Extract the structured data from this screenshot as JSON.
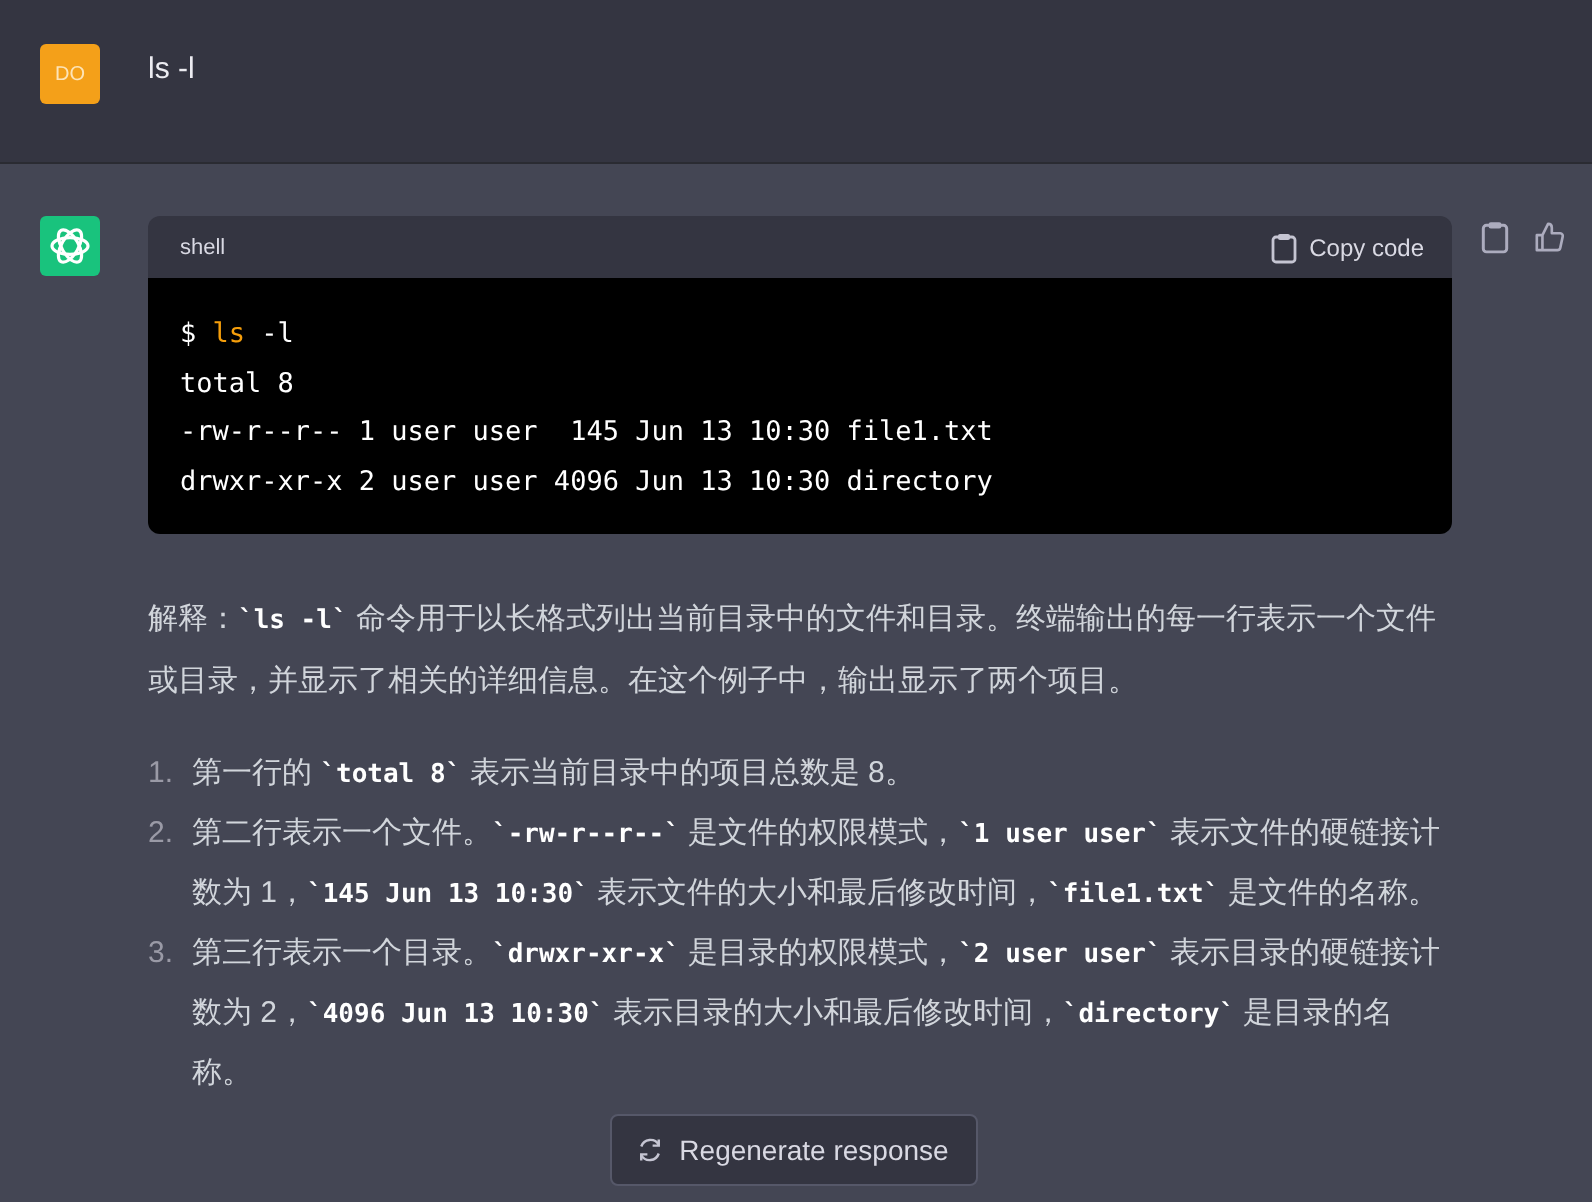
{
  "user_message": {
    "avatar": "DO",
    "text": "ls -l"
  },
  "code_block": {
    "language": "shell",
    "copy_label": "Copy code",
    "lines": [
      {
        "kind": "command",
        "prompt": "$",
        "command": "ls",
        "args": "-l"
      },
      {
        "kind": "output",
        "text": "total 8"
      },
      {
        "kind": "output",
        "text": "-rw-r--r-- 1 user user  145 Jun 13 10:30 file1.txt"
      },
      {
        "kind": "output",
        "text": "drwxr-xr-x 2 user user 4096 Jun 13 10:30 directory"
      }
    ]
  },
  "paragraph": [
    {
      "kind": "text",
      "text": "解释："
    },
    {
      "kind": "code",
      "text": "`ls -l`"
    },
    {
      "kind": "text",
      "text": " 命令用于以长格式列出当前目录中的文件和目录。终端输出的每一行表示一个文件或目录，并显示了相关的详细信息。在这个例子中，输出显示了两个项目。"
    }
  ],
  "list": [
    {
      "number": "1.",
      "segments": [
        {
          "kind": "text",
          "text": "第一行的 "
        },
        {
          "kind": "code",
          "text": "`total 8`"
        },
        {
          "kind": "text",
          "text": " 表示当前目录中的项目总数是 8。"
        }
      ]
    },
    {
      "number": "2.",
      "segments": [
        {
          "kind": "text",
          "text": "第二行表示一个文件。"
        },
        {
          "kind": "code",
          "text": "`-rw-r--r--`"
        },
        {
          "kind": "text",
          "text": " 是文件的权限模式，"
        },
        {
          "kind": "code",
          "text": "`1 user user`"
        },
        {
          "kind": "text",
          "text": " 表示文件的硬链接计数为 1，"
        },
        {
          "kind": "code",
          "text": "`145 Jun 13 10:30`"
        },
        {
          "kind": "text",
          "text": " 表示文件的大小和最后修改时间，"
        },
        {
          "kind": "code",
          "text": "`file1.txt`"
        },
        {
          "kind": "text",
          "text": " 是文件的名称。"
        }
      ]
    },
    {
      "number": "3.",
      "segments": [
        {
          "kind": "text",
          "text": "第三行表示一个目录。"
        },
        {
          "kind": "code",
          "text": "`drwxr-xr-x`"
        },
        {
          "kind": "text",
          "text": " 是目录的权限模式，"
        },
        {
          "kind": "code",
          "text": "`2 user user`"
        },
        {
          "kind": "text",
          "text": " 表示目录的硬链接计数为 2，"
        },
        {
          "kind": "code",
          "text": "`4096 Jun 13 10:30`"
        },
        {
          "kind": "text",
          "text": " 表示目录的大小和最后修改时间，"
        },
        {
          "kind": "code",
          "text": "`directory`"
        },
        {
          "kind": "text",
          "text": " 是目录的名称。"
        }
      ]
    }
  ],
  "regenerate_button": {
    "label": "Regenerate response"
  }
}
